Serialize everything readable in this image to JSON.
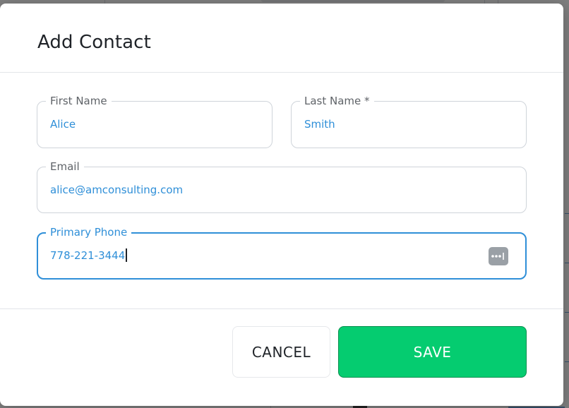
{
  "modal": {
    "title": "Add Contact"
  },
  "form": {
    "first_name": {
      "label": "First Name",
      "value": "Alice"
    },
    "last_name": {
      "label": "Last Name *",
      "value": "Smith"
    },
    "email": {
      "label": "Email",
      "value": "alice@amconsulting.com"
    },
    "primary_phone": {
      "label": "Primary Phone",
      "value": "778-221-3444",
      "focused": true
    }
  },
  "actions": {
    "cancel_label": "CANCEL",
    "save_label": "SAVE"
  },
  "icons": {
    "password_manager": "password-manager-icon"
  },
  "colors": {
    "accent": "#2f8fd8",
    "save_green": "#05cc70",
    "overlay": "#8f9194"
  }
}
